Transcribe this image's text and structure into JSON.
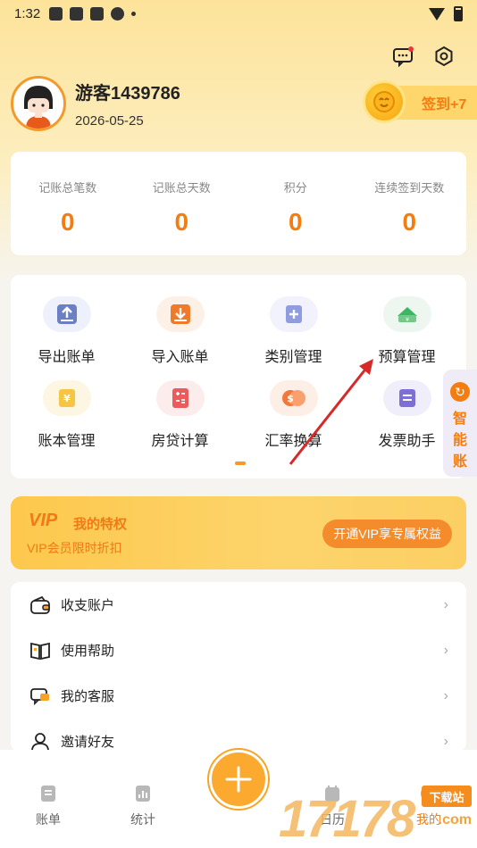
{
  "status_bar": {
    "time": "1:32"
  },
  "profile": {
    "username": "游客1439786",
    "date": "2026-05-25"
  },
  "checkin": {
    "label": "签到+7"
  },
  "stats": [
    {
      "label": "记账总笔数",
      "value": "0"
    },
    {
      "label": "记账总天数",
      "value": "0"
    },
    {
      "label": "积分",
      "value": "0"
    },
    {
      "label": "连续签到天数",
      "value": "0"
    }
  ],
  "tools": [
    {
      "label": "导出账单",
      "icon": "export-icon"
    },
    {
      "label": "导入账单",
      "icon": "import-icon"
    },
    {
      "label": "类别管理",
      "icon": "category-icon"
    },
    {
      "label": "预算管理",
      "icon": "budget-icon"
    },
    {
      "label": "账本管理",
      "icon": "ledger-icon"
    },
    {
      "label": "房贷计算",
      "icon": "calculator-icon"
    },
    {
      "label": "汇率换算",
      "icon": "exchange-icon"
    },
    {
      "label": "发票助手",
      "icon": "invoice-icon"
    }
  ],
  "smart_panel": {
    "text": "智能账"
  },
  "vip": {
    "logo": "VIP",
    "title": "我的特权",
    "subtitle": "VIP会员限时折扣",
    "button": "开通VIP享专属权益"
  },
  "menu": [
    {
      "label": "收支账户",
      "icon": "wallet-icon"
    },
    {
      "label": "使用帮助",
      "icon": "book-icon"
    },
    {
      "label": "我的客服",
      "icon": "chat-icon"
    },
    {
      "label": "邀请好友",
      "icon": "user-icon"
    }
  ],
  "bottom_nav": [
    {
      "label": "账单"
    },
    {
      "label": "统计"
    },
    {
      "label": "日历"
    },
    {
      "label": "我的"
    }
  ],
  "watermark": {
    "number": "17178",
    "text": "下载站",
    "url": ".com"
  },
  "colors": {
    "accent": "#f47d10",
    "vip_bg": "#fdc84c"
  }
}
